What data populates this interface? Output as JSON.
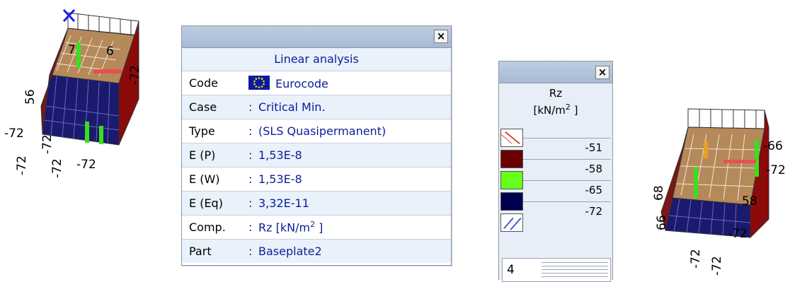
{
  "model_left": {
    "labels": [
      "-72",
      "56",
      "-72",
      "-72",
      "-72",
      "-72",
      "-72",
      "7",
      "6"
    ]
  },
  "model_right": {
    "labels": [
      "-66",
      "-72",
      "-72",
      "-72",
      "-72",
      "68",
      "66",
      "58"
    ]
  },
  "info_window": {
    "close_label": "×",
    "heading": "Linear analysis",
    "rows": [
      {
        "key": "Code",
        "sep": "",
        "value": "Eurocode"
      },
      {
        "key": "Case",
        "sep": ":",
        "value": "Critical Min."
      },
      {
        "key": "Type",
        "sep": ":",
        "value": "(SLS Quasipermanent)"
      },
      {
        "key": "E (P)",
        "sep": ":",
        "value": "1,53E-8"
      },
      {
        "key": "E (W)",
        "sep": ":",
        "value": "1,53E-8"
      },
      {
        "key": "E (Eq)",
        "sep": ":",
        "value": "3,32E-11"
      },
      {
        "key": "Comp.",
        "sep": ":",
        "value_main": "Rz [kN/m",
        "value_sup": "2",
        "value_end": " ]"
      },
      {
        "key": "Part",
        "sep": ":",
        "value": "Baseplate2"
      }
    ]
  },
  "legend_window": {
    "close_label": "×",
    "title_line1": "Rz",
    "title_main": "[kN/m",
    "title_sup": "2",
    "title_end": " ]",
    "values": [
      "-51",
      "-58",
      "-65",
      "-72"
    ],
    "swatch_colors": [
      "#6b0000",
      "#66ff1a",
      "#000050"
    ],
    "levels": "4"
  }
}
